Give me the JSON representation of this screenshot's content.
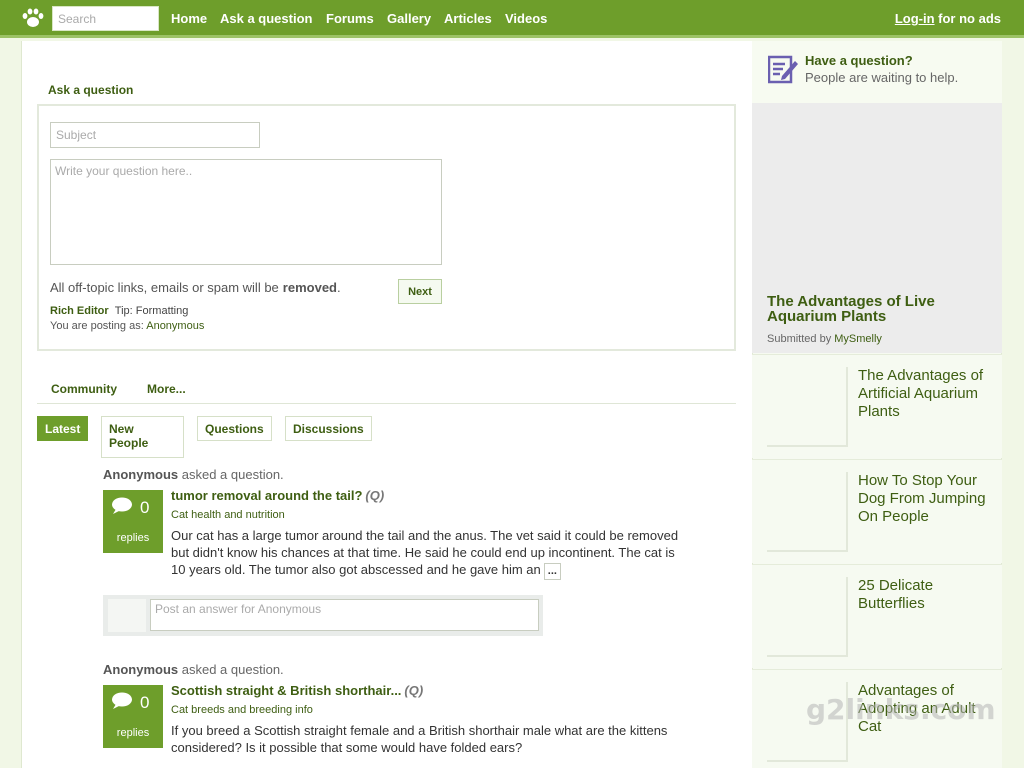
{
  "nav": {
    "search_placeholder": "Search",
    "links": [
      "Home",
      "Ask a question",
      "Forums",
      "Gallery",
      "Articles",
      "Videos"
    ],
    "login_link": "Log-in",
    "login_suffix": " for no ads"
  },
  "ask": {
    "tab_label": "Ask a question",
    "subject_placeholder": "Subject",
    "question_placeholder": "Write your question here..",
    "spam_note": "All off-topic links, emails or spam will be",
    "spam_note_emphasis": "removed",
    "spam_note_end": ".",
    "next_label": "Next",
    "rich_editor": "Rich Editor",
    "tip": "Tip: Formatting",
    "posting_as": "You are posting as:",
    "posting_user": "Anonymous"
  },
  "community": {
    "tabs": [
      "Community",
      "More..."
    ],
    "filters": [
      "Latest",
      "New People",
      "Questions",
      "Discussions"
    ],
    "active_filter": "Latest"
  },
  "questions": [
    {
      "asker": "Anonymous",
      "action": "asked a question.",
      "replies_count": "0",
      "replies_label": "replies",
      "title": "tumor removal around the tail?",
      "tag": "(Q)",
      "category": "Cat health and nutrition",
      "body": "Our cat has a large tumor around the tail and the anus. The vet said it could be removed but didn't know his chances at that time. He said he could end up incontinent. The cat is 10 years old. The tumor also got abscessed and he gave him an",
      "more": "...",
      "answer_placeholder": "Post an answer for Anonymous"
    },
    {
      "asker": "Anonymous",
      "action": "asked a question.",
      "replies_count": "0",
      "replies_label": "replies",
      "title": "Scottish straight & British shorthair...",
      "tag": "(Q)",
      "category": "Cat breeds and breeding info",
      "body": "If you breed a Scottish straight female and a British shorthair male what are the kittens considered? Is it possible that some would have folded ears?"
    }
  ],
  "sidebar": {
    "have_question_title": "Have a question?",
    "have_question_sub": "People are waiting to help.",
    "feature_title": "The Advantages of Live Aquarium Plants",
    "feature_by": "Submitted by",
    "feature_user": "MySmelly",
    "articles": [
      "The Advantages of Artificial Aquarium Plants",
      "How To Stop Your Dog From Jumping On People",
      "25 Delicate Butterflies",
      "Advantages of Adopting an Adult Cat"
    ]
  },
  "watermark": "g2links.com",
  "colors": {
    "brand_green": "#6e9e2b",
    "link_green": "#3e5e12"
  }
}
